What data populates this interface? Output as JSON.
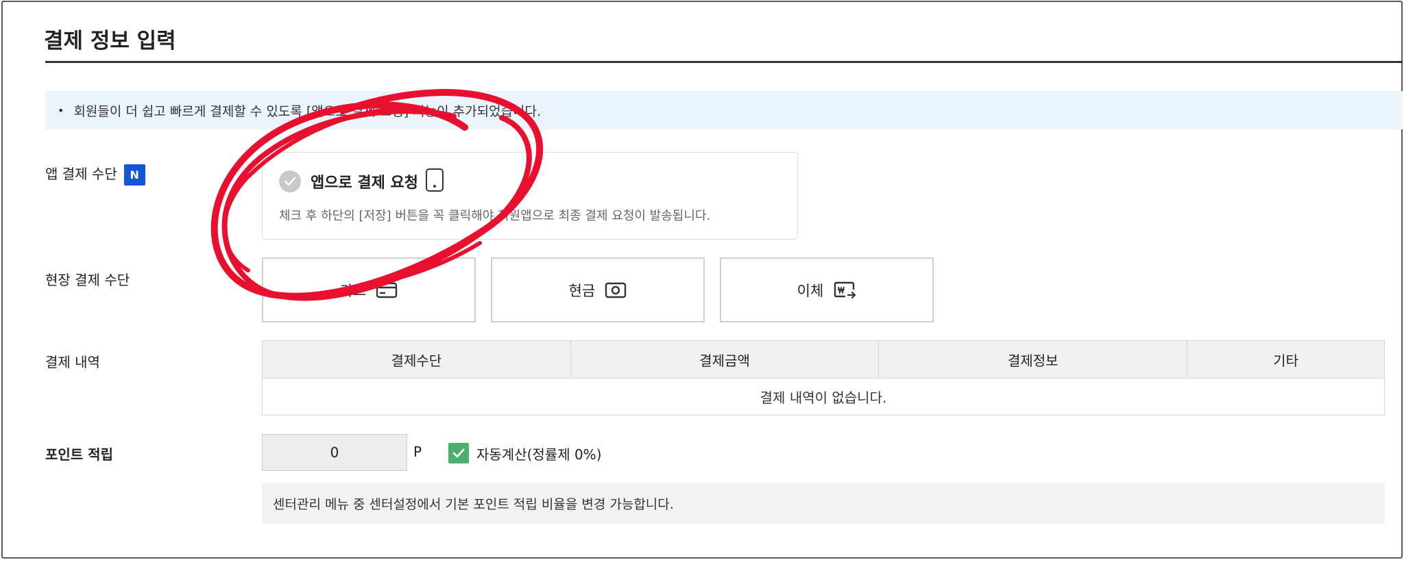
{
  "page": {
    "title": "결제 정보 입력"
  },
  "notice": {
    "text": "회원들이 더 쉽고 빠르게 결제할 수 있도록 [앱으로 결제 요청] 기능이 추가되었습니다."
  },
  "app_payment": {
    "label": "앱 결제 수단",
    "badge": "N",
    "option_title": "앱으로 결제 요청",
    "description": "체크 후 하단의 [저장] 버튼을 꼭 클릭해야 회원앱으로 최종 결제 요청이 발송됩니다.",
    "checked": false
  },
  "onsite_payment": {
    "label": "현장 결제 수단",
    "buttons": [
      {
        "label": "카드",
        "icon": "card-icon"
      },
      {
        "label": "현금",
        "icon": "cash-icon"
      },
      {
        "label": "이체",
        "icon": "transfer-icon"
      }
    ]
  },
  "history": {
    "label": "결제 내역",
    "columns": [
      "결제수단",
      "결제금액",
      "결제정보",
      "기타"
    ],
    "empty_text": "결제 내역이 없습니다."
  },
  "points": {
    "label": "포인트 적립",
    "value": "0",
    "unit": "P",
    "auto_calc_label": "자동계산(정률제 0%)",
    "auto_calc_checked": true,
    "note": "센터관리 메뉴 중 센터설정에서 기본 포인트 적립 비율을 변경 가능합니다."
  },
  "colors": {
    "badge": "#1356d8",
    "notice_bg": "#edf5fc",
    "check_green": "#4caf6e",
    "annotation_red": "#e8102e"
  }
}
